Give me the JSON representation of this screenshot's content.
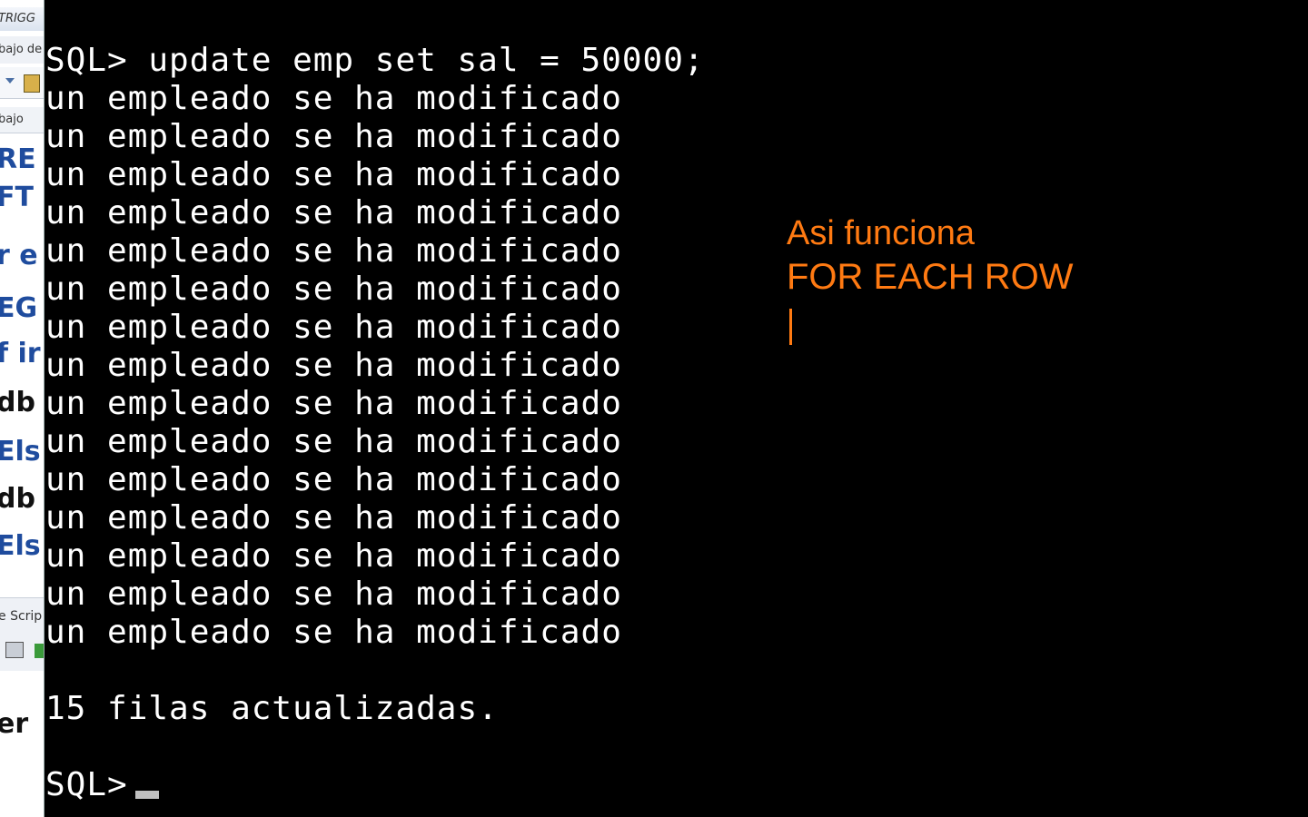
{
  "side_app": {
    "tab_text": "TRIGG",
    "bar_text": "bajo de",
    "header_text": "bajo",
    "code_lines": [
      {
        "text": "RE",
        "color": "blue"
      },
      {
        "text": "FT",
        "color": "blue"
      },
      {
        "text": "r e",
        "color": "blue"
      },
      {
        "text": "EG",
        "color": "blue"
      },
      {
        "text": "f ir",
        "color": "blue"
      },
      {
        "text": " db",
        "color": "black"
      },
      {
        "text": "Els",
        "color": "blue"
      },
      {
        "text": " db",
        "color": "black"
      },
      {
        "text": "Els",
        "color": "blue"
      }
    ],
    "lower_label": "e Scrip",
    "bottom_text": "er"
  },
  "console": {
    "command_line": "SQL> update emp set sal = 50000;",
    "output_lines": [
      "un empleado se ha modificado",
      "un empleado se ha modificado",
      "un empleado se ha modificado",
      "un empleado se ha modificado",
      "un empleado se ha modificado",
      "un empleado se ha modificado",
      "un empleado se ha modificado",
      "un empleado se ha modificado",
      "un empleado se ha modificado",
      "un empleado se ha modificado",
      "un empleado se ha modificado",
      "un empleado se ha modificado",
      "un empleado se ha modificado",
      "un empleado se ha modificado",
      "un empleado se ha modificado"
    ],
    "result_line": "15 filas actualizadas.",
    "prompt": "SQL>"
  },
  "annotation": {
    "line1": "Asi funciona",
    "line2": "FOR EACH ROW",
    "color": "#ff7a12"
  }
}
